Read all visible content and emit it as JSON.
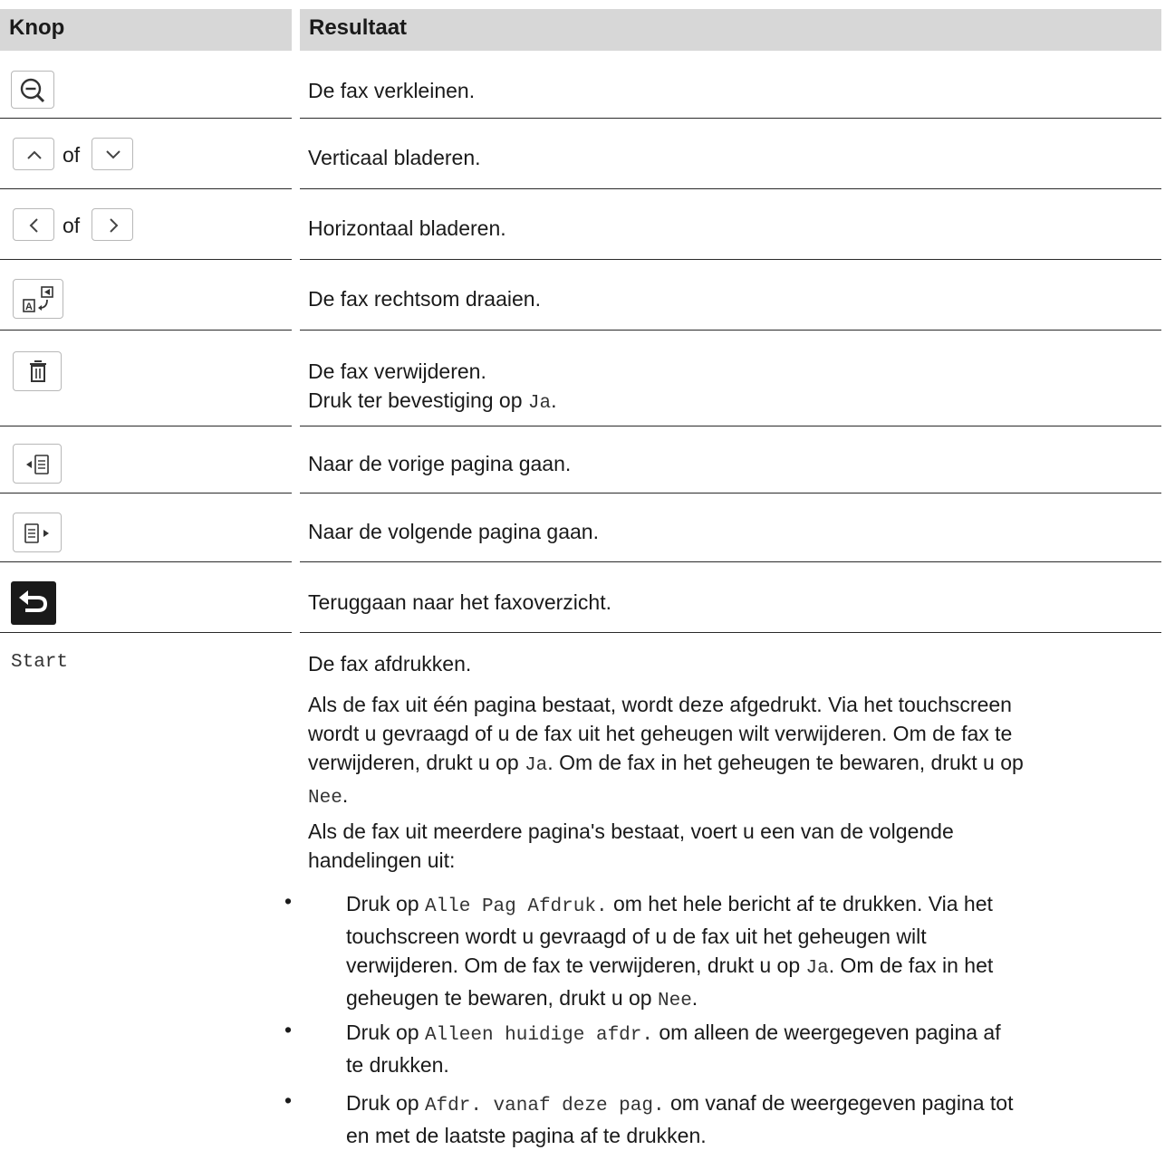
{
  "header": {
    "col_knop": "Knop",
    "col_resultaat": "Resultaat"
  },
  "rows": [
    {
      "icon": "zoom-out-icon",
      "result": "De fax verkleinen."
    },
    {
      "icon": "scroll-up-down-icons",
      "of": "of",
      "result": "Verticaal bladeren."
    },
    {
      "icon": "scroll-left-right-icons",
      "of": "of",
      "result": "Horizontaal bladeren."
    },
    {
      "icon": "rotate-clockwise-icon",
      "result": "De fax rechtsom draaien."
    },
    {
      "icon": "trash-icon",
      "result_line1": "De fax verwijderen.",
      "result_line2_pre": "Druk ter bevestiging op ",
      "result_line2_code": "Ja",
      "result_line2_post": "."
    },
    {
      "icon": "previous-page-icon",
      "result": "Naar de vorige pagina gaan."
    },
    {
      "icon": "next-page-icon",
      "result": "Naar de volgende pagina gaan."
    },
    {
      "icon": "back-icon",
      "result": "Teruggaan naar het faxoverzicht."
    }
  ],
  "start": {
    "knop": "Start",
    "line1": "De fax afdrukken.",
    "para1": {
      "l1": "Als de fax uit één pagina bestaat, wordt deze afgedrukt. Via het touchscreen",
      "l2": "wordt u gevraagd of u de fax uit het geheugen wilt verwijderen. Om de fax te",
      "l3_pre": "verwijderen, drukt u op ",
      "l3_code": "Ja",
      "l3_post": ". Om de fax in het geheugen te bewaren, drukt u op",
      "l4_code": "Nee",
      "l4_post": "."
    },
    "para2": {
      "l1": "Als de fax uit meerdere pagina's bestaat, voert u een van de volgende",
      "l2": "handelingen uit:"
    },
    "bullets": [
      {
        "l1_pre": "Druk op ",
        "l1_code": "Alle Pag Afdruk.",
        "l1_post": " om het hele bericht af te drukken. Via het",
        "l2": "touchscreen wordt u gevraagd of u de fax uit het geheugen wilt",
        "l3_pre": "verwijderen. Om de fax te verwijderen, drukt u op ",
        "l3_code": "Ja",
        "l3_post": ". Om de fax in het",
        "l4_pre": "geheugen te bewaren, drukt u op ",
        "l4_code": "Nee",
        "l4_post": "."
      },
      {
        "l1_pre": "Druk op ",
        "l1_code": "Alleen huidige afdr.",
        "l1_post": " om alleen de weergegeven pagina af",
        "l2": "te drukken."
      },
      {
        "l1_pre": "Druk op ",
        "l1_code": "Afdr. vanaf deze pag.",
        "l1_post": " om vanaf de weergegeven pagina tot",
        "l2": "en met de laatste pagina af te drukken."
      }
    ],
    "bullet_char": "•"
  }
}
